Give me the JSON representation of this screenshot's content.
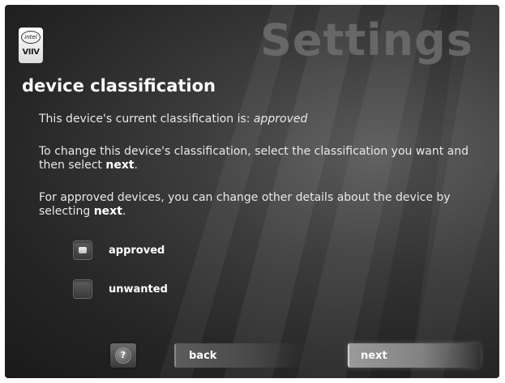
{
  "header": {
    "title": "Settings",
    "logo_top": "intel",
    "logo_bottom": "VIIV"
  },
  "page": {
    "heading": "device classification",
    "current_prefix": "This device's current classification is: ",
    "current_value": "approved",
    "instruction_1_pre": "To change this device's classification, select the classification you want and then select ",
    "instruction_1_bold": "next",
    "instruction_1_post": ".",
    "instruction_2_pre": "For approved devices, you can change other details about the device by selecting ",
    "instruction_2_bold": "next",
    "instruction_2_post": "."
  },
  "options": [
    {
      "label": "approved",
      "selected": true
    },
    {
      "label": "unwanted",
      "selected": false
    }
  ],
  "footer": {
    "help_label": "?",
    "back_label": "back",
    "next_label": "next"
  },
  "colors": {
    "background": "#2c2c2c",
    "text": "#e9e9e9",
    "title_watermark": "#6e6e6e"
  }
}
